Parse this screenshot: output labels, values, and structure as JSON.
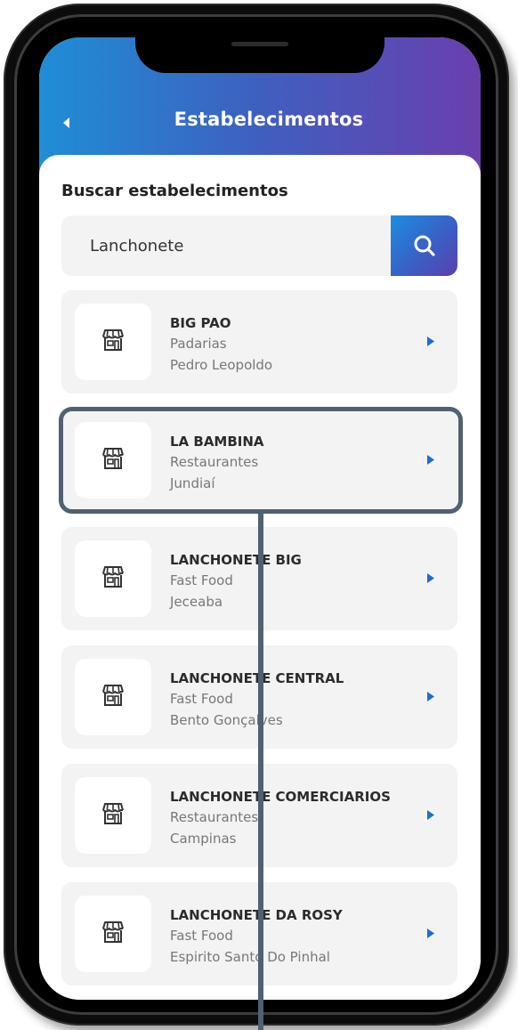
{
  "header": {
    "title": "Estabelecimentos"
  },
  "search": {
    "label": "Buscar estabelecimentos",
    "value": "Lanchonete"
  },
  "colors": {
    "accent_start": "#1f8ed6",
    "accent_end": "#6a3fae",
    "highlight": "#4f6172",
    "arrow": "#1b6fd4"
  },
  "icons": {
    "back": "back-arrow-icon",
    "search": "search-icon",
    "store": "store-icon",
    "chevron": "chevron-right-icon"
  },
  "results": [
    {
      "name": "BIG PAO",
      "category": "Padarias",
      "city": "Pedro Leopoldo"
    },
    {
      "name": "LA BAMBINA",
      "category": "Restaurantes",
      "city": "Jundiaí"
    },
    {
      "name": "LANCHONETE BIG",
      "category": "Fast Food",
      "city": "Jeceaba"
    },
    {
      "name": "LANCHONETE CENTRAL",
      "category": "Fast Food",
      "city": "Bento Gonçalves"
    },
    {
      "name": "LANCHONETE COMERCIARIOS",
      "category": "Restaurantes",
      "city": "Campinas"
    },
    {
      "name": "LANCHONETE DA ROSY",
      "category": "Fast Food",
      "city": "Espirito Santo Do Pinhal"
    }
  ]
}
